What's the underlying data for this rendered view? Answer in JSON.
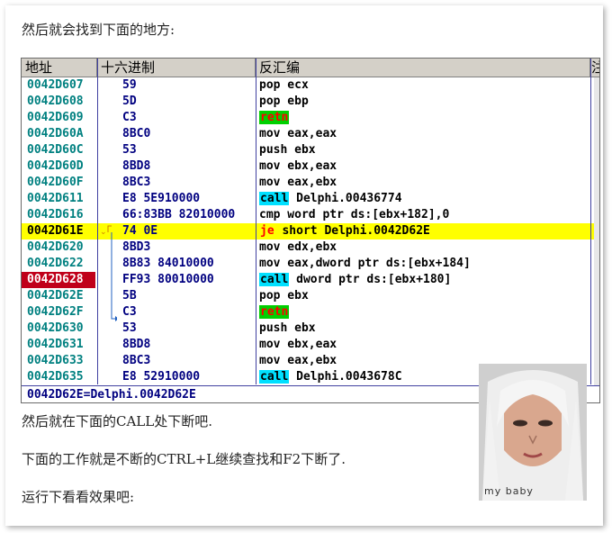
{
  "article": {
    "para1": "然后就会找到下面的地方:",
    "para2": "然后就在下面的CALL处下断吧.",
    "para3": "下面的工作就是不断的CTRL+L继续查找和F2下断了.",
    "para4": "运行下看看效果吧:"
  },
  "debugger": {
    "columns": [
      "地址",
      "十六进制",
      "反汇编",
      "注"
    ],
    "rows": [
      {
        "addr": "0042D607",
        "hex": "59",
        "kw": "",
        "asm": "pop ecx",
        "state": ""
      },
      {
        "addr": "0042D608",
        "hex": "5D",
        "kw": "",
        "asm": "pop ebp",
        "state": ""
      },
      {
        "addr": "0042D609",
        "hex": "C3",
        "kw": "retn",
        "asm": "",
        "state": ""
      },
      {
        "addr": "0042D60A",
        "hex": "8BC0",
        "kw": "",
        "asm": "mov eax,eax",
        "state": ""
      },
      {
        "addr": "0042D60C",
        "hex": "53",
        "kw": "",
        "asm": "push ebx",
        "state": ""
      },
      {
        "addr": "0042D60D",
        "hex": "8BD8",
        "kw": "",
        "asm": "mov ebx,eax",
        "state": ""
      },
      {
        "addr": "0042D60F",
        "hex": "8BC3",
        "kw": "",
        "asm": "mov eax,ebx",
        "state": ""
      },
      {
        "addr": "0042D611",
        "hex": "E8 5E910000",
        "kw": "call",
        "asm": " Delphi.00436774",
        "state": ""
      },
      {
        "addr": "0042D616",
        "hex": "66:83BB 82010000",
        "kw": "",
        "asm": "cmp word ptr ds:[ebx+182],0",
        "state": ""
      },
      {
        "addr": "0042D61E",
        "hex": "74 0E",
        "kw": "je",
        "asm": " short Delphi.0042D62E",
        "state": "selected"
      },
      {
        "addr": "0042D620",
        "hex": "8BD3",
        "kw": "",
        "asm": "mov edx,ebx",
        "state": ""
      },
      {
        "addr": "0042D622",
        "hex": "8B83 84010000",
        "kw": "",
        "asm": "mov eax,dword ptr ds:[ebx+184]",
        "state": ""
      },
      {
        "addr": "0042D628",
        "hex": "FF93 80010000",
        "kw": "call",
        "asm": " dword ptr ds:[ebx+180]",
        "state": "breakpoint"
      },
      {
        "addr": "0042D62E",
        "hex": "5B",
        "kw": "",
        "asm": "pop ebx",
        "state": ""
      },
      {
        "addr": "0042D62F",
        "hex": "C3",
        "kw": "retn",
        "asm": "",
        "state": ""
      },
      {
        "addr": "0042D630",
        "hex": "53",
        "kw": "",
        "asm": "push ebx",
        "state": ""
      },
      {
        "addr": "0042D631",
        "hex": "8BD8",
        "kw": "",
        "asm": "mov ebx,eax",
        "state": ""
      },
      {
        "addr": "0042D633",
        "hex": "8BC3",
        "kw": "",
        "asm": "mov eax,ebx",
        "state": ""
      },
      {
        "addr": "0042D635",
        "hex": "E8 52910000",
        "kw": "call",
        "asm": " Delphi.0043678C",
        "state": ""
      }
    ],
    "status": "0042D62E=Delphi.0042D62E"
  },
  "photo": {
    "caption": "my baby"
  },
  "colors": {
    "address": "#008080",
    "hex": "#000080",
    "selected_row": "#ffff00",
    "breakpoint": "#c0001a",
    "retn_bg": "#00d000",
    "call_bg": "#00e0ff"
  }
}
